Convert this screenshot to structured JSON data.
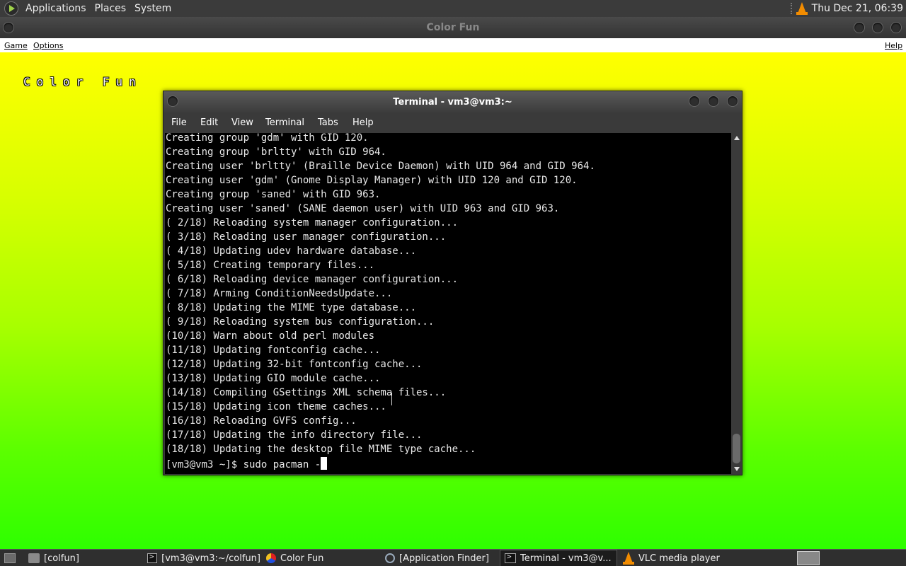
{
  "top_panel": {
    "menus": [
      "Applications",
      "Places",
      "System"
    ],
    "clock": "Thu Dec 21, 06:39"
  },
  "colorfun_window": {
    "title": "Color Fun",
    "menus": {
      "game": "Game",
      "options": "Options",
      "help": "Help"
    },
    "canvas_title": "Color Fun",
    "colors": {
      "top": "#ffff00",
      "bottom": "#2eff00"
    }
  },
  "terminal_window": {
    "title": "Terminal - vm3@vm3:~",
    "menus": [
      "File",
      "Edit",
      "View",
      "Terminal",
      "Tabs",
      "Help"
    ],
    "lines": [
      "Creating group 'gdm' with GID 120.",
      "Creating group 'brltty' with GID 964.",
      "Creating user 'brltty' (Braille Device Daemon) with UID 964 and GID 964.",
      "Creating user 'gdm' (Gnome Display Manager) with UID 120 and GID 120.",
      "Creating group 'saned' with GID 963.",
      "Creating user 'saned' (SANE daemon user) with UID 963 and GID 963.",
      "( 2/18) Reloading system manager configuration...",
      "( 3/18) Reloading user manager configuration...",
      "( 4/18) Updating udev hardware database...",
      "( 5/18) Creating temporary files...",
      "( 6/18) Reloading device manager configuration...",
      "( 7/18) Arming ConditionNeedsUpdate...",
      "( 8/18) Updating the MIME type database...",
      "( 9/18) Reloading system bus configuration...",
      "(10/18) Warn about old perl modules",
      "(11/18) Updating fontconfig cache...",
      "(12/18) Updating 32-bit fontconfig cache...",
      "(13/18) Updating GIO module cache...",
      "(14/18) Compiling GSettings XML schema files...",
      "(15/18) Updating icon theme caches...",
      "(16/18) Reloading GVFS config...",
      "(17/18) Updating the info directory file...",
      "(18/18) Updating the desktop file MIME type cache..."
    ],
    "prompt": "[vm3@vm3 ~]$ ",
    "command": "sudo pacman -"
  },
  "taskbar": {
    "tasks": [
      {
        "label": "[colfun]",
        "icon": "folder-icon"
      },
      {
        "label": "[vm3@vm3:~/colfun]",
        "icon": "terminal-icon"
      },
      {
        "label": "Color Fun",
        "icon": "colorfun-icon"
      },
      {
        "label": "[Application Finder]",
        "icon": "search-icon"
      },
      {
        "label": "Terminal - vm3@v...",
        "icon": "terminal-icon"
      },
      {
        "label": "VLC media player",
        "icon": "vlc-icon"
      }
    ]
  }
}
